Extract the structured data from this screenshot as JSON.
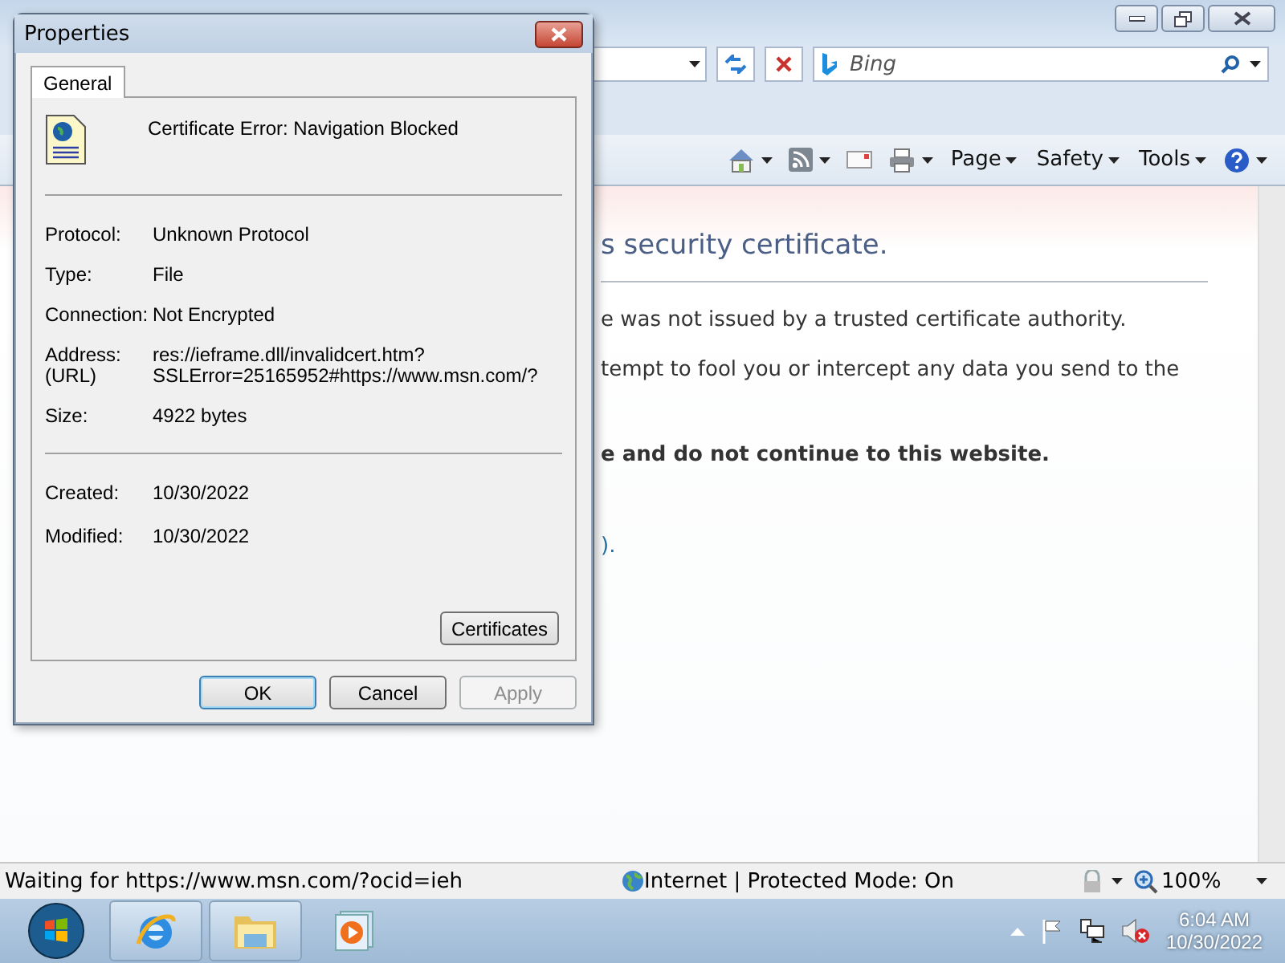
{
  "browser": {
    "search_placeholder": "Bing",
    "command_bar": [
      {
        "label": "Page"
      },
      {
        "label": "Safety"
      },
      {
        "label": "Tools"
      }
    ],
    "page": {
      "heading": "s security certificate.",
      "paragraphs": [
        {
          "kind": "text",
          "text": "e was not issued by a trusted certificate authority."
        },
        {
          "kind": "text",
          "text": "tempt to fool you or intercept any data you send to the"
        },
        {
          "kind": "bold",
          "text": "e and do not continue to this website."
        },
        {
          "kind": "link",
          "text": ")."
        }
      ]
    },
    "status_bar": {
      "text": "Waiting for https://www.msn.com/?ocid=ieh",
      "zone": "Internet | Protected Mode: On",
      "zoom": "100%"
    }
  },
  "dialog": {
    "title": "Properties",
    "tabs": [
      {
        "label": "General",
        "selected": true
      }
    ],
    "name": "Certificate Error: Navigation Blocked",
    "sections": [
      [
        {
          "label": "Protocol:",
          "value": "Unknown Protocol"
        },
        {
          "label": "Type:",
          "value": "File"
        },
        {
          "label": "Connection:",
          "value": "Not Encrypted"
        },
        {
          "label": "Address:\n(URL)",
          "value": "res://ieframe.dll/invalidcert.htm?\nSSLError=25165952#https://www.msn.com/?"
        },
        {
          "label": "Size:",
          "value": "4922 bytes"
        }
      ],
      [
        {
          "label": "Created:",
          "value": "10/30/2022"
        },
        {
          "label": "Modified:",
          "value": "10/30/2022"
        }
      ]
    ],
    "panel_button": "Certificates",
    "buttons": [
      {
        "label": "OK",
        "default": true,
        "disabled": false
      },
      {
        "label": "Cancel",
        "default": false,
        "disabled": false
      },
      {
        "label": "Apply",
        "default": false,
        "disabled": true
      }
    ]
  },
  "taskbar": {
    "time": "6:04 AM",
    "date": "10/30/2022"
  }
}
